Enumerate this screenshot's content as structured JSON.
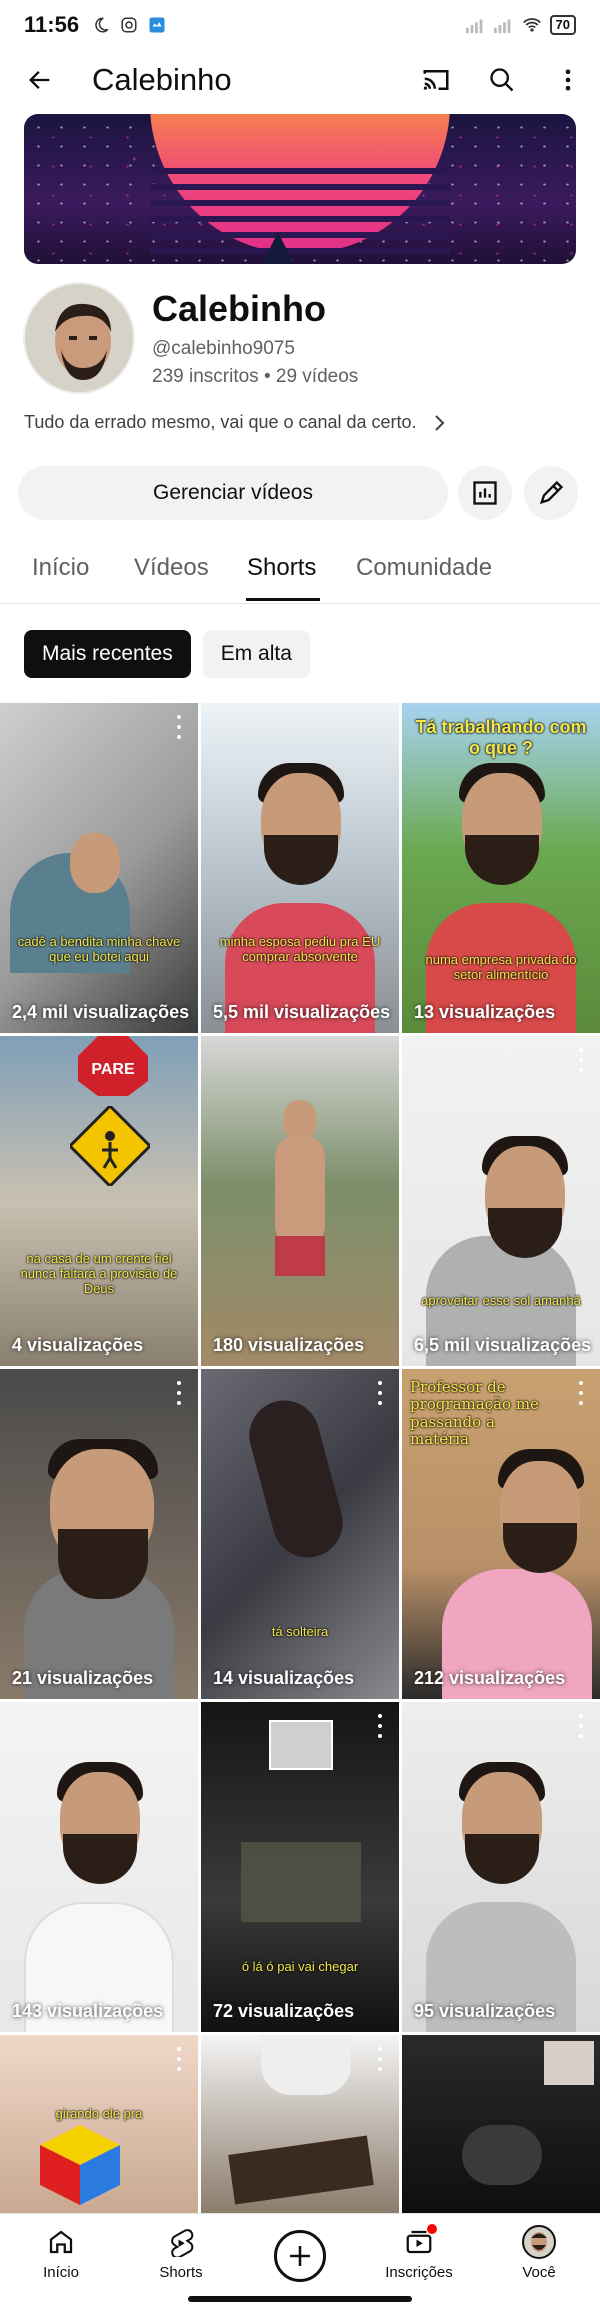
{
  "status_bar": {
    "time": "11:56",
    "battery": "70"
  },
  "app_bar": {
    "title": "Calebinho"
  },
  "channel": {
    "name": "Calebinho",
    "handle": "@calebinho9075",
    "stats": "239 inscritos • 29 vídeos",
    "description": "Tudo da errado mesmo, vai que o canal da certo.",
    "manage_label": "Gerenciar vídeos"
  },
  "tabs": [
    {
      "label": "Início"
    },
    {
      "label": "Vídeos"
    },
    {
      "label": "Shorts"
    },
    {
      "label": "Comunidade"
    }
  ],
  "active_tab": "Shorts",
  "chips": [
    {
      "label": "Mais recentes",
      "active": true
    },
    {
      "label": "Em alta",
      "active": false
    }
  ],
  "shorts": [
    {
      "views": "2,4 mil visualizações",
      "caption": "cadê a bendita minha chave que eu botei aqui"
    },
    {
      "views": "5,5 mil visualizações",
      "caption": "minha esposa pediu pra EU comprar absorvente"
    },
    {
      "views": "13 visualizações",
      "caption": "numa empresa privada do setor alimentício",
      "top_caption": "Tá trabalhando com o que ?"
    },
    {
      "views": "4 visualizações",
      "caption": "na casa de um crente fiel nunca faltará a provisão de Deus"
    },
    {
      "views": "180 visualizações",
      "caption": ""
    },
    {
      "views": "6,5 mil visualizações",
      "caption": "aproveitar esse sol amanhã"
    },
    {
      "views": "21 visualizações",
      "caption": ""
    },
    {
      "views": "14 visualizações",
      "caption": "tá solteira"
    },
    {
      "views": "212 visualizações",
      "caption": "",
      "top_caption": "Professor de programação me passando a matéria"
    },
    {
      "views": "143 visualizações",
      "caption": ""
    },
    {
      "views": "72 visualizações",
      "caption": "ó lá ó pai vai chegar"
    },
    {
      "views": "95 visualizações",
      "caption": ""
    },
    {
      "views": "",
      "caption": "girando ele pra"
    },
    {
      "views": "",
      "caption": ""
    },
    {
      "views": "",
      "caption": ""
    }
  ],
  "bottom_nav": [
    {
      "label": "Início"
    },
    {
      "label": "Shorts"
    },
    {
      "label": ""
    },
    {
      "label": "Inscrições"
    },
    {
      "label": "Você"
    }
  ],
  "colors": {
    "accent": "#0f0f0f",
    "notification": "#ff0000",
    "caption_yellow": "#f4e64a"
  }
}
